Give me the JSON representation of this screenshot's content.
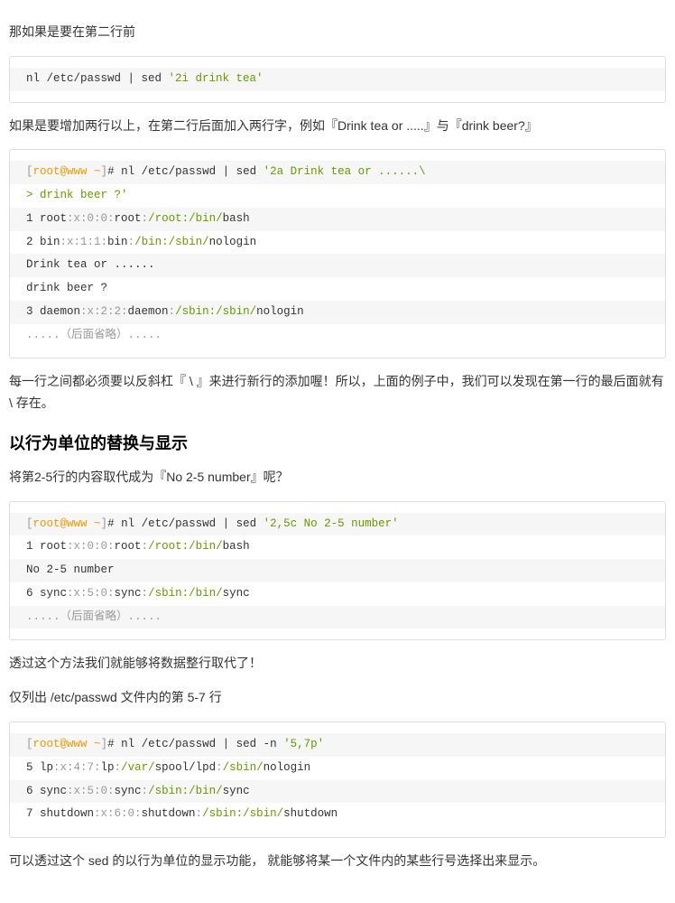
{
  "paragraphs": {
    "p1": "那如果是要在第二行前",
    "p2": "如果是要增加两行以上，在第二行后面加入两行字，例如『Drink tea or .....』与『drink beer?』",
    "p3": "每一行之间都必须要以反斜杠『 \\ 』来进行新行的添加喔！所以，上面的例子中，我们可以发现在第一行的最后面就有 \\ 存在。",
    "p4": "将第2-5行的内容取代成为『No 2-5 number』呢？",
    "p5": "透过这个方法我们就能够将数据整行取代了！",
    "p6": "仅列出 /etc/passwd 文件内的第 5-7 行",
    "p7": "可以透过这个 sed 的以行为单位的显示功能， 就能够将某一个文件内的某些行号选择出来显示。"
  },
  "headings": {
    "h1": "以行为单位的替换与显示"
  },
  "code1": {
    "line1_pre": "nl /etc/passwd | sed ",
    "line1_str": "'2i drink tea'"
  },
  "code2": {
    "l1a": "[",
    "l1b": "root@www ",
    "l1c": "~",
    "l1d": "]",
    "l1e": "# nl /etc/passwd | sed ",
    "l1f": "'2a Drink tea or ......\\",
    "l2": "> drink beer ?'",
    "l3a": "1 root",
    "l3b": ":x:0:0:",
    "l3c": "root",
    "l3d": ":",
    "l3e": "/root:",
    "l3f": "/bin/",
    "l3g": "bash",
    "l4a": "2 bin",
    "l4b": ":x:1:1:",
    "l4c": "bin",
    "l4d": ":",
    "l4e": "/bin:",
    "l4f": "/sbin/",
    "l4g": "nologin",
    "l5": "Drink tea or ......",
    "l6": "drink beer ?",
    "l7a": "3 daemon",
    "l7b": ":x:2:2:",
    "l7c": "daemon",
    "l7d": ":",
    "l7e": "/sbin:",
    "l7f": "/sbin/",
    "l7g": "nologin",
    "l8a": ".....",
    "l8b": "（后面省略）",
    "l8c": "....."
  },
  "code3": {
    "l1a": "[",
    "l1b": "root@www ",
    "l1c": "~",
    "l1d": "]",
    "l1e": "# nl /etc/passwd | sed ",
    "l1f": "'2,5c No 2-5 number'",
    "l2a": "1 root",
    "l2b": ":x:0:0:",
    "l2c": "root",
    "l2d": ":",
    "l2e": "/root:",
    "l2f": "/bin/",
    "l2g": "bash",
    "l3": "No 2-5 number",
    "l4a": "6 sync",
    "l4b": ":x:5:0:",
    "l4c": "sync",
    "l4d": ":",
    "l4e": "/sbin:",
    "l4f": "/bin/",
    "l4g": "sync",
    "l5a": ".....",
    "l5b": "（后面省略）",
    "l5c": "....."
  },
  "code4": {
    "l1a": "[",
    "l1b": "root@www ",
    "l1c": "~",
    "l1d": "]",
    "l1e": "# nl /etc/passwd | sed -n ",
    "l1f": "'5,7p'",
    "l2a": "5 lp",
    "l2b": ":x:4:7:",
    "l2c": "lp",
    "l2d": ":",
    "l2e": "/var/",
    "l2f": "spool/lpd",
    "l2g": ":",
    "l2h": "/sbin/",
    "l2i": "nologin",
    "l3a": "6 sync",
    "l3b": ":x:5:0:",
    "l3c": "sync",
    "l3d": ":",
    "l3e": "/sbin:",
    "l3f": "/bin/",
    "l3g": "sync",
    "l4a": "7 shutdown",
    "l4b": ":x:6:0:",
    "l4c": "shutdown",
    "l4d": ":",
    "l4e": "/sbin:",
    "l4f": "/sbin/",
    "l4g": "shutdown"
  }
}
